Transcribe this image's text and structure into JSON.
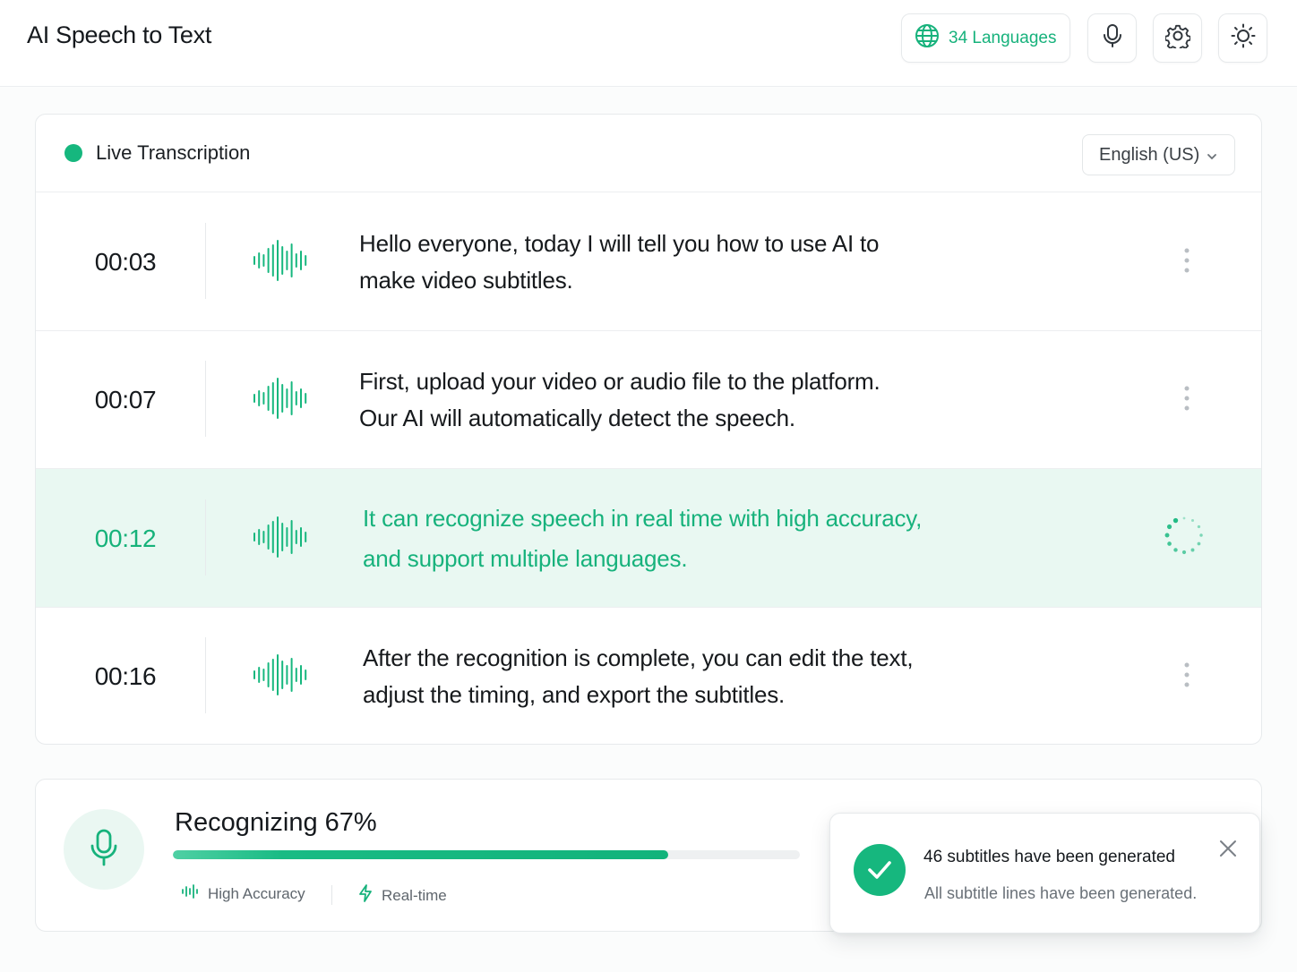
{
  "header": {
    "title": "AI Speech to Text",
    "languages_label": "34 Languages",
    "icons": {
      "languages": "globe-icon",
      "mic": "microphone-icon",
      "settings": "gear-icon",
      "theme": "sun-icon"
    }
  },
  "transcription": {
    "title": "Live Transcription",
    "language": "English (US)",
    "segments": [
      {
        "time": "00:03",
        "line1": "Hello everyone, today I will tell you how to use AI to",
        "line2": "make video subtitles.",
        "state": "done"
      },
      {
        "time": "00:07",
        "line1": "First, upload your video or audio file to the platform.",
        "line2": "Our AI will automatically detect the speech.",
        "state": "done"
      },
      {
        "time": "00:12",
        "line1": "It can recognize speech in real time with high accuracy,",
        "line2": "and support multiple languages.",
        "state": "processing"
      },
      {
        "time": "00:16",
        "line1": "After the recognition is complete, you can edit the text,",
        "line2": "adjust the timing, and export the subtitles.",
        "state": "done"
      }
    ]
  },
  "status": {
    "label": "Recognizing 67%",
    "progress": 0.79,
    "features": [
      {
        "label": "High Accuracy",
        "icon": "soundwave-icon"
      },
      {
        "label": "Real-time",
        "icon": "lightning-icon"
      }
    ]
  },
  "toast": {
    "title": "46 subtitles have been generated",
    "message": "All subtitle lines have been generated."
  },
  "colors": {
    "accent": "#16b77e",
    "accent_text": "#17b27c",
    "active_row_bg": "#e9f8f2"
  }
}
